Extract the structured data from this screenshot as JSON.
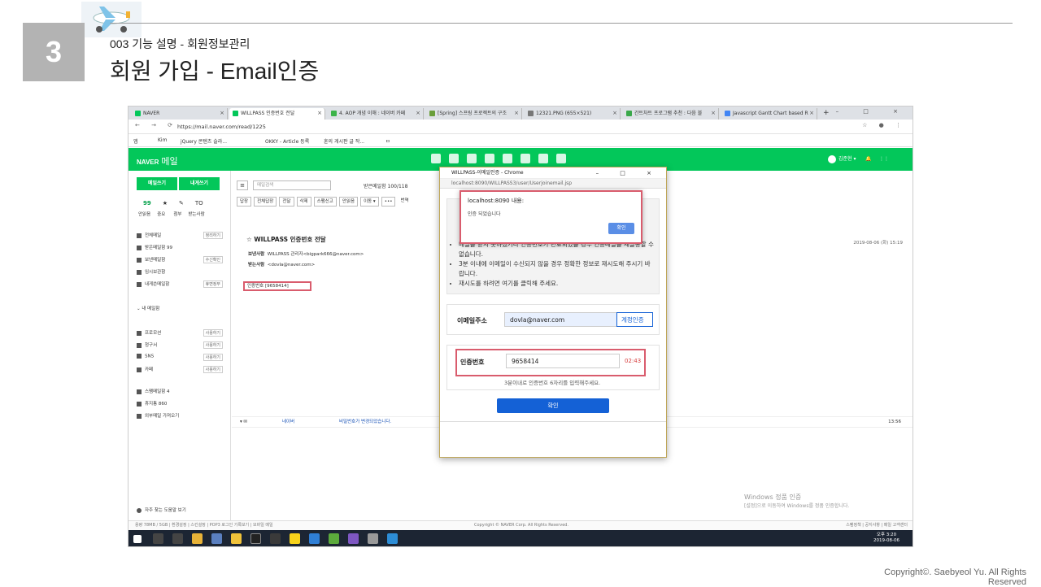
{
  "slide": {
    "number": "3",
    "subtitle": "003 기능 설명 - 회원정보관리",
    "title": "회원 가입 - Email인증",
    "copyright": "Copyright©. Saebyeol Yu. All Rights Reserved"
  },
  "browser": {
    "tabs": [
      "NAVER",
      "WILLPASS 인증번호 전달",
      "4. AOP 개념 이해 : 네이버 카페",
      "[Spring] 스프링 프로젝트의 구조",
      "12321.PNG (655×521)",
      "간트차트 프로그램 추천 : 다음 블",
      "Javascript Gantt Chart based R"
    ],
    "url": "https://mail.naver.com/read/1225",
    "bookmarks": [
      "앱",
      "Kim",
      "jQuery 콘텐츠 슬라...",
      "OKKY - Article 등록",
      "혼의 게시판 글 작...",
      "ㅁ"
    ]
  },
  "naver": {
    "logo": "NAVER",
    "logo_sub": "메일",
    "user": "김준현",
    "write_btn": "메일쓰기",
    "self_btn": "내게쓰기",
    "stats": [
      "99",
      "★",
      "✎",
      "TO"
    ],
    "stat_labels": [
      "안읽음",
      "중요",
      "첨부",
      "받는사람"
    ],
    "folders": [
      "전체메일",
      "받은메일함 99",
      "보낸메일함",
      "임시보관함",
      "내게쓴메일함"
    ],
    "folder_tags": [
      "정리하기",
      "",
      "수신확인",
      "",
      "휴면정부"
    ],
    "my_mail": "내 메일함",
    "extra": [
      "프로모션",
      "청구서",
      "SNS",
      "카페"
    ],
    "extra_tag": "사용하기",
    "spam": [
      "스팸메일함 4",
      "휴지통 860",
      "외부메일 가져오기"
    ],
    "help": "자주 찾는 도움말 보기",
    "search_placeholder": "메일검색",
    "inbox_count": "받은메일함 100/118",
    "toolbar": [
      "답장",
      "전체답장",
      "전달",
      "삭제",
      "스팸신고",
      "안읽음",
      "이동 ▾",
      "•••",
      "번역"
    ],
    "mail_subject": "WILLPASS 인증번호 전달",
    "sender_label": "보낸사람",
    "sender": "WILLPASS 관리자<bigpark666@naver.com>",
    "receiver_label": "받는사람",
    "receiver": "<dovla@naver.com>",
    "date": "2019-08-06 (화) 15:19",
    "auth_code_text": "인증번호 [9658414]",
    "list_sender": "네이버",
    "list_subject": "비밀번호가 변경되었습니다.",
    "list_time": "13:56",
    "footer": "용량 78MB / 5GB  |  환경설정  |  스킨설정  |  POP3 로그인 기록보기  |  모바일 메일",
    "footer_center": "Copyright © NAVER Corp. All Rights Reserved.",
    "footer_right": "스팸정책  |  공지사항  |  메일 고객센터"
  },
  "popup": {
    "title": "WILLPASS-이메일인증 - Chrome",
    "url": "localhost:8090/WILLPASS3/user/Userjoinemail.jsp",
    "info": [
      "메일을 받지 못하셨거나 인증번호가 만료되었을 경우 인증메일을 재발송할 수 없습니다.",
      "3분 이내에 이메일이 수신되지 않을 경우 정확한 정보로 재시도해 주시기 바랍니다.",
      "재시도를 하려면 여기를 클릭해 주세요."
    ],
    "email_label": "이메일주소",
    "email_value": "dovla@naver.com",
    "email_btn": "계정인증",
    "code_label": "인증번호",
    "code_value": "9658414",
    "timer": "02:43",
    "code_hint": "3분이내로 인증번호 6자리를 입력해주세요.",
    "confirm": "확인"
  },
  "alert": {
    "title": "localhost:8090 내용:",
    "message": "인증 되었습니다",
    "ok": "확인"
  },
  "windows": {
    "watermark1": "Windows 정품 인증",
    "watermark2": "[설정]으로 이동하여 Windows를 정품 인증합니다.",
    "time": "오후 3:20",
    "date": "2019-08-06"
  },
  "colors": {
    "naver_green": "#03c75a",
    "highlight": "#d95c6d",
    "confirm_blue": "#1461d6"
  }
}
